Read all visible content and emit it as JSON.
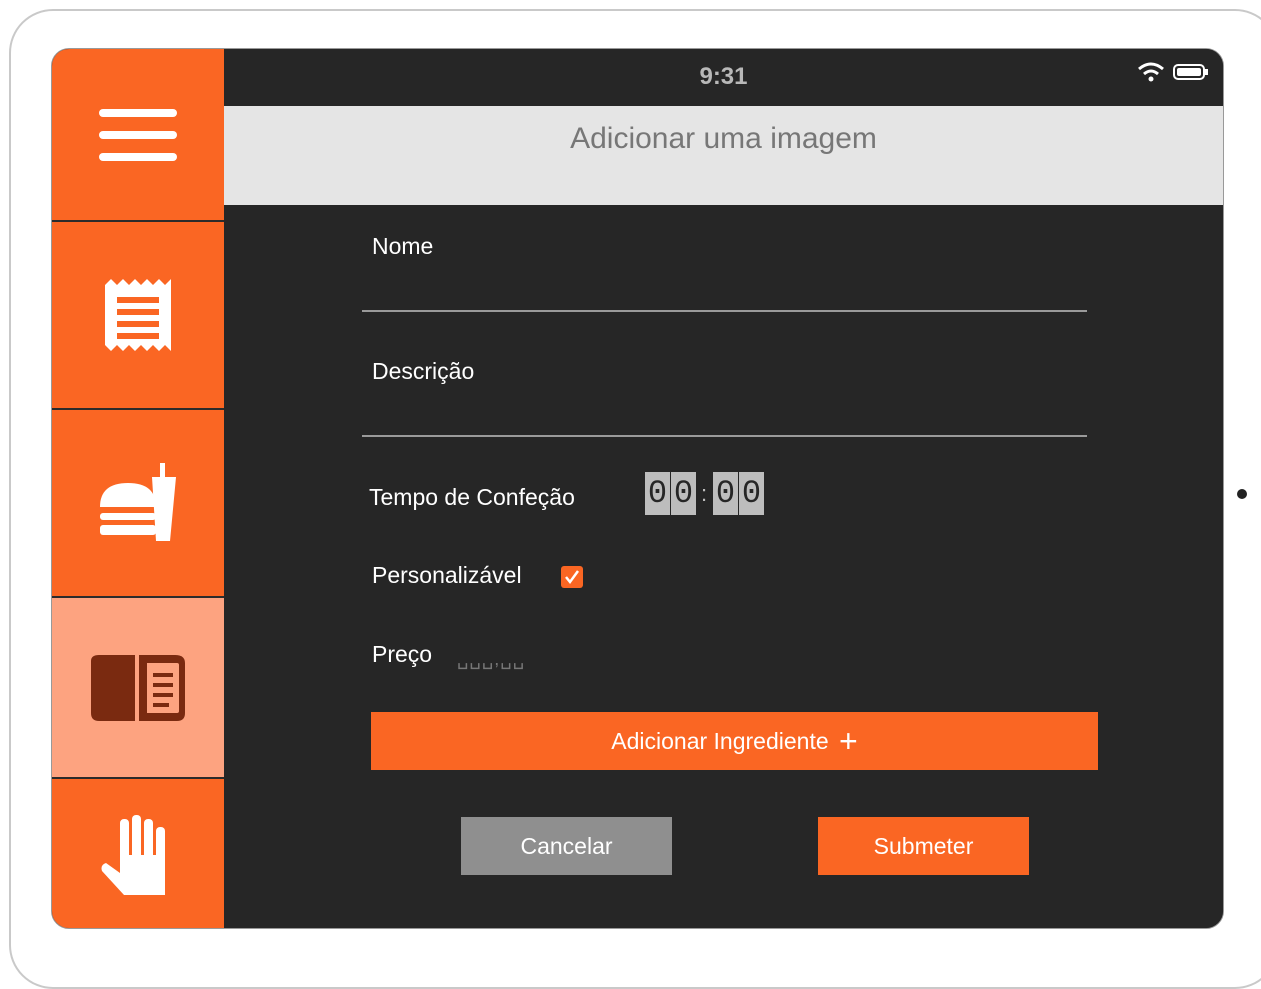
{
  "status": {
    "time": "9:31"
  },
  "header": {
    "add_image": "Adicionar uma imagem"
  },
  "sidebar": {
    "items": [
      {
        "icon": "menu-icon"
      },
      {
        "icon": "receipt-icon"
      },
      {
        "icon": "burger-drink-icon"
      },
      {
        "icon": "menu-book-icon",
        "active": true
      },
      {
        "icon": "hand-icon"
      }
    ],
    "accent": "#fa6623",
    "active_bg": "#fda380"
  },
  "form": {
    "name_label": "Nome",
    "name_value": "",
    "description_label": "Descrição",
    "description_value": "",
    "prep_time_label": "Tempo de Confeção",
    "prep_time_digits": [
      "0",
      "0",
      "0",
      "0"
    ],
    "prep_time_separator": ":",
    "customizable_label": "Personalizável",
    "customizable_checked": true,
    "price_label": "Preço",
    "price_placeholder": "␣␣␣,␣␣"
  },
  "buttons": {
    "add_ingredient": "Adicionar Ingrediente",
    "add_ingredient_plus": "+",
    "cancel": "Cancelar",
    "submit": "Submeter"
  }
}
